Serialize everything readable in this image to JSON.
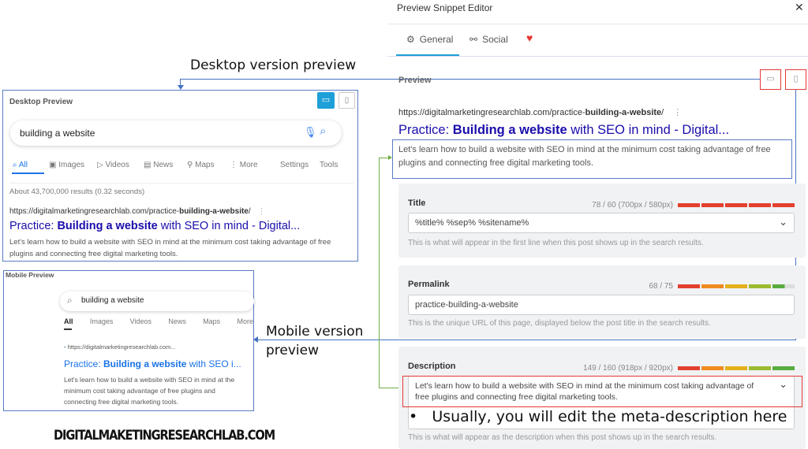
{
  "annotations": {
    "desktop": "Desktop version preview",
    "mobile_line1": "Mobile version",
    "mobile_line2": "preview",
    "bullet": "Usually, you will edit the meta-description here"
  },
  "logo": "DIGITALMAKETINGRESEARCHLAB.COM",
  "desktop_preview": {
    "label": "Desktop Preview",
    "query": "building a website",
    "tabs": [
      "All",
      "Images",
      "Videos",
      "News",
      "Maps",
      "More"
    ],
    "settings": "Settings",
    "tools": "Tools",
    "results_count": "About 43,700,000 results (0.32 seconds)",
    "url_prefix": "https://digitalmarketingresearchlab.com/practice-",
    "url_bold": "building-a-website",
    "url_suffix": "/",
    "title_prefix": "Practice: ",
    "title_bold": "Building a website",
    "title_suffix": " with SEO in mind - Digital...",
    "description": "Let's learn how to build a website with SEO in mind at the minimum cost taking advantage of free plugins and connecting free digital marketing tools."
  },
  "mobile_preview": {
    "label": "Mobile Preview",
    "query": "building a website",
    "tabs": [
      "All",
      "Images",
      "Videos",
      "News",
      "Maps",
      "More"
    ],
    "url": "https://digitalmarketingresearchlab.com...",
    "title_prefix": "Practice: ",
    "title_bold": "Building a website",
    "title_suffix": " with SEO i...",
    "description": "Let's learn how to build a website with SEO in mind at the minimum cost taking advantage of free plugins and connecting free digital marketing tools."
  },
  "editor": {
    "title": "Preview Snippet Editor",
    "tabs": [
      {
        "label": "General",
        "active": true
      },
      {
        "label": "Social"
      }
    ],
    "preview_label": "Preview",
    "preview": {
      "url_prefix": "https://digitalmarketingresearchlab.com/practice-",
      "url_bold": "building-a-website",
      "url_suffix": "/",
      "title_prefix": "Practice: ",
      "title_bold": "Building a website",
      "title_suffix": " with SEO in mind - Digital...",
      "description": "Let's learn how to build a website with SEO in mind at the minimum cost taking advantage of free plugins and connecting free digital marketing tools."
    },
    "fields": {
      "title": {
        "label": "Title",
        "counter": "78 / 60 (700px / 580px)",
        "value": "%title% %sep% %sitename%",
        "help": "This is what will appear in the first line when this post shows up in the search results."
      },
      "permalink": {
        "label": "Permalink",
        "counter": "68 / 75",
        "value": "practice-building-a-website",
        "help": "This is the unique URL of this page, displayed below the post title in the search results."
      },
      "description": {
        "label": "Description",
        "counter": "149 / 160 (918px / 920px)",
        "value": "Let's learn how to build a website with SEO in mind at the minimum cost taking advantage of free plugins and connecting free digital marketing tools.",
        "help": "This is what will appear as the description when this post shows up in the search results."
      }
    }
  },
  "colors": {
    "link": "#1a0dab",
    "accent": "#1e9fd8",
    "heart": "#e53935",
    "red": "#e2402f",
    "orange": "#ef8a1f",
    "yellow": "#e3b01b",
    "lime": "#9bbb2e",
    "green": "#57ad3e"
  }
}
